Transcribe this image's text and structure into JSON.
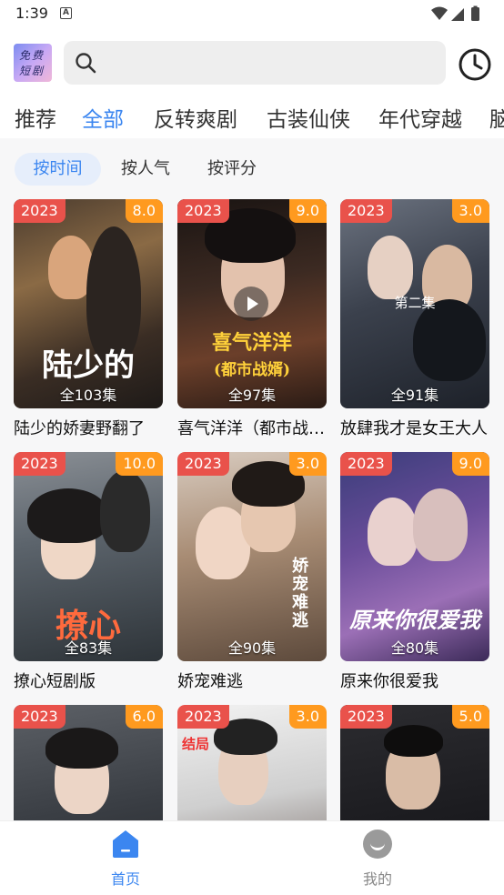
{
  "status_bar": {
    "time": "1:39",
    "notification_icon": "A"
  },
  "header": {
    "logo_text": [
      "免费",
      "短剧"
    ],
    "search": {
      "placeholder": ""
    }
  },
  "category_tabs": [
    {
      "label": "推荐",
      "active": false
    },
    {
      "label": "全部",
      "active": true
    },
    {
      "label": "反转爽剧",
      "active": false
    },
    {
      "label": "古装仙侠",
      "active": false
    },
    {
      "label": "年代穿越",
      "active": false
    },
    {
      "label": "脑",
      "active": false
    }
  ],
  "sort_options": [
    {
      "label": "按时间",
      "active": true
    },
    {
      "label": "按人气",
      "active": false
    },
    {
      "label": "按评分",
      "active": false
    }
  ],
  "dramas": [
    {
      "year": "2023",
      "score": "8.0",
      "episodes": "全103集",
      "title": "陆少的娇妻野翻了",
      "poster_text": "陆少的"
    },
    {
      "year": "2023",
      "score": "9.0",
      "episodes": "全97集",
      "title": "喜气洋洋（都市战婿）",
      "poster_text": "喜气洋洋",
      "poster_sub": "(都市战婿)"
    },
    {
      "year": "2023",
      "score": "3.0",
      "episodes": "全91集",
      "title": "放肆我才是女王大人",
      "poster_text": "第二集"
    },
    {
      "year": "2023",
      "score": "10.0",
      "episodes": "全83集",
      "title": "撩心短剧版",
      "poster_text": "撩心"
    },
    {
      "year": "2023",
      "score": "3.0",
      "episodes": "全90集",
      "title": "娇宠难逃",
      "poster_text": "娇宠难逃"
    },
    {
      "year": "2023",
      "score": "9.0",
      "episodes": "全80集",
      "title": "原来你很爱我",
      "poster_text": "原来你很爱我"
    },
    {
      "year": "2023",
      "score": "6.0",
      "episodes": "",
      "title": "",
      "poster_text": ""
    },
    {
      "year": "2023",
      "score": "3.0",
      "episodes": "",
      "title": "",
      "poster_text": "结局"
    },
    {
      "year": "2023",
      "score": "5.0",
      "episodes": "",
      "title": "",
      "poster_text": ""
    }
  ],
  "bottom_nav": [
    {
      "label": "首页",
      "icon": "home-icon",
      "active": true
    },
    {
      "label": "我的",
      "icon": "smile-icon",
      "active": false
    }
  ],
  "colors": {
    "accent": "#3b86f0",
    "year_badge": "#e9524b",
    "score_badge": "#ff9a1f"
  }
}
